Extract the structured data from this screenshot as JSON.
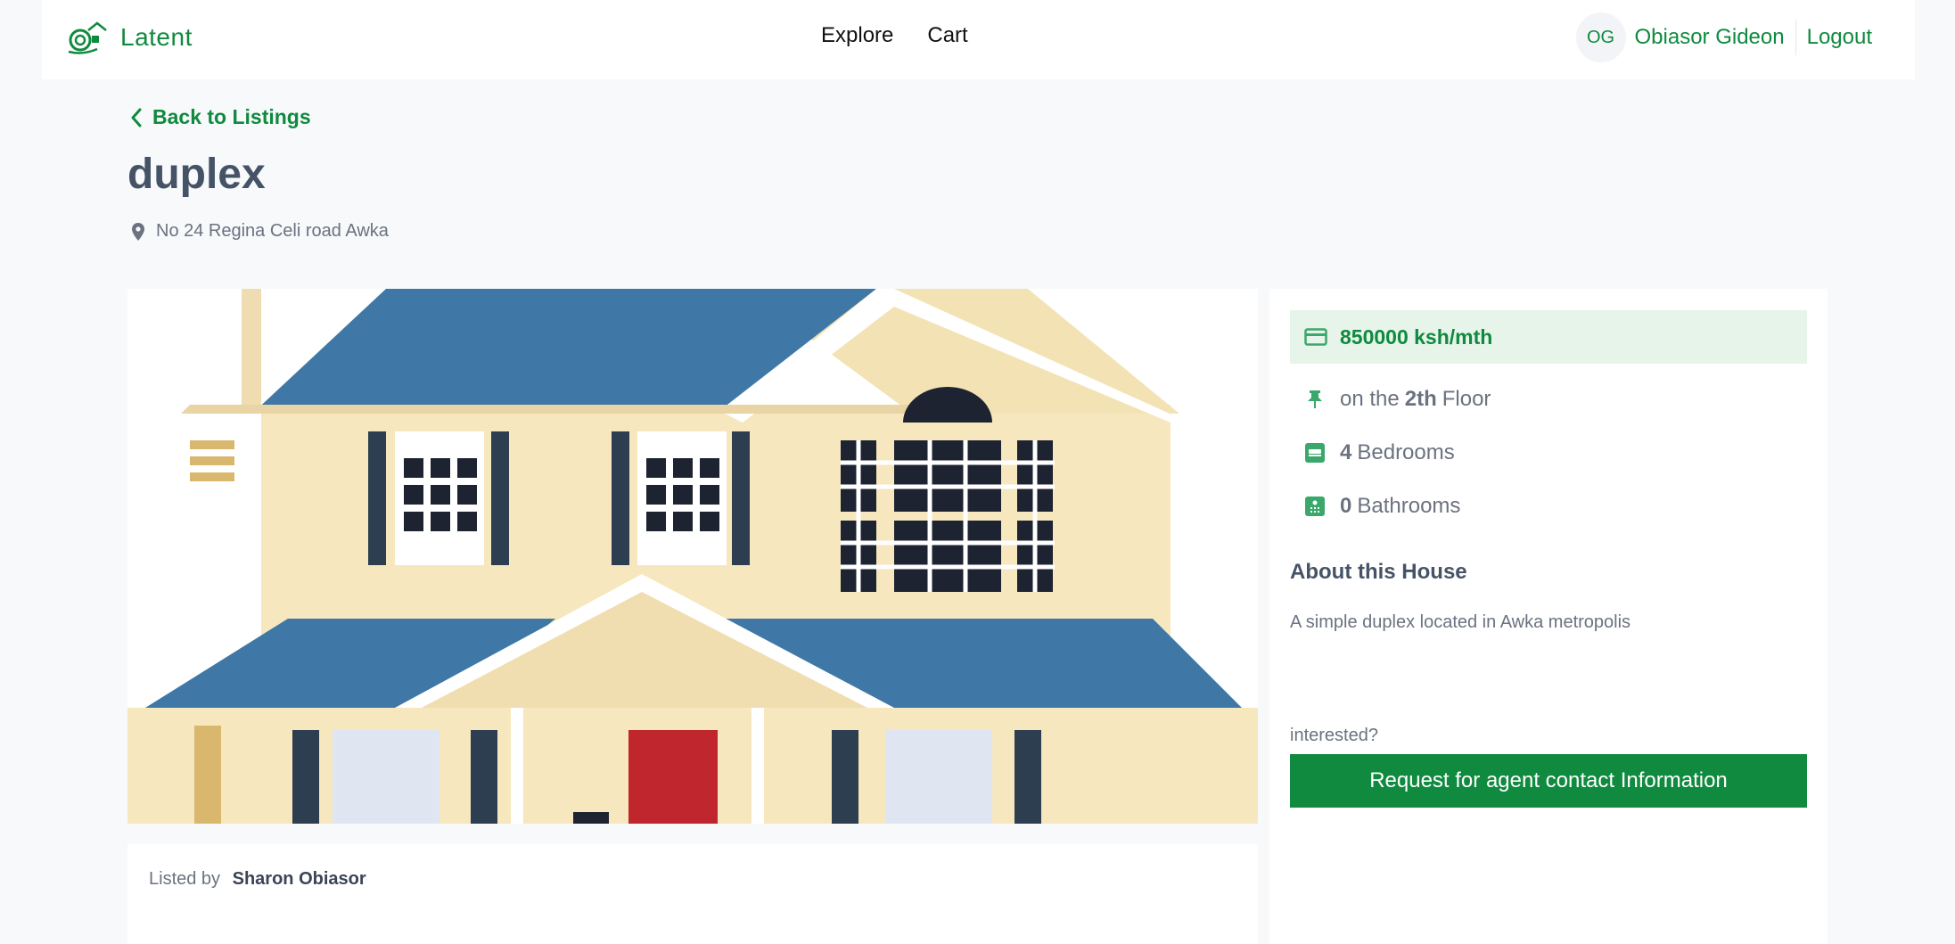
{
  "header": {
    "brand": "Latent",
    "nav": [
      "Explore",
      "Cart"
    ],
    "user_initials": "OG",
    "user_name": "Obiasor Gideon",
    "logout_label": "Logout"
  },
  "back_label": "Back to Listings",
  "listing": {
    "title": "duplex",
    "address": "No 24 Regina Celi road Awka",
    "price": "850000 ksh/mth",
    "floor_prefix": "on the",
    "floor_value": "2th",
    "floor_suffix": "Floor",
    "bedrooms": "4",
    "bedrooms_label": "Bedrooms",
    "bathrooms": "0",
    "bathrooms_label": "Bathrooms",
    "about_heading": "About this House",
    "about_text": "A simple duplex located in Awka metropolis",
    "interested_label": "interested?",
    "cta_label": "Request for agent contact Information",
    "listed_by_label": "Listed by",
    "listed_by_name": "Sharon Obiasor"
  },
  "colors": {
    "brand_green": "#0f8a3e",
    "price_bg": "#e6f4ea",
    "page_bg": "#f7f9fb",
    "roof_blue": "#3f78a6",
    "wall_cream": "#f6e7bf",
    "door_red": "#c0262d"
  },
  "icons": {
    "logo": "house-logo-icon",
    "back": "chevron-left-icon",
    "address": "map-pin-icon",
    "price": "credit-card-icon",
    "floor": "pin-icon",
    "bedrooms": "bed-icon",
    "bathrooms": "bath-icon"
  }
}
